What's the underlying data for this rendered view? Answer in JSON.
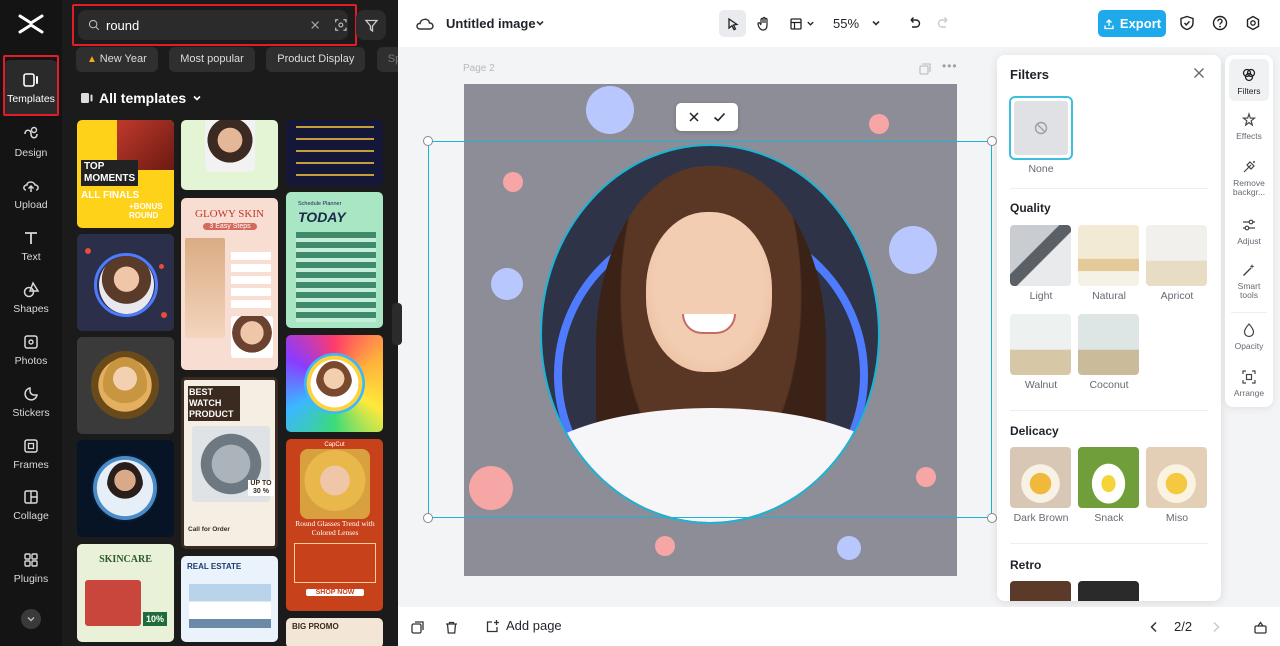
{
  "nav": {
    "items": [
      {
        "label": "Templates",
        "icon": "templates-icon"
      },
      {
        "label": "Design",
        "icon": "design-icon"
      },
      {
        "label": "Upload",
        "icon": "upload-icon"
      },
      {
        "label": "Text",
        "icon": "text-icon"
      },
      {
        "label": "Shapes",
        "icon": "shapes-icon"
      },
      {
        "label": "Photos",
        "icon": "photos-icon"
      },
      {
        "label": "Stickers",
        "icon": "stickers-icon"
      },
      {
        "label": "Frames",
        "icon": "frames-icon"
      },
      {
        "label": "Collage",
        "icon": "collage-icon"
      },
      {
        "label": "Plugins",
        "icon": "plugins-icon"
      }
    ]
  },
  "templates_panel": {
    "search_value": "round",
    "chips": [
      "New Year",
      "Most popular",
      "Product Display",
      "Spri"
    ],
    "all_templates_label": "All templates",
    "thumb_text": {
      "top_moments": "TOP\nMOMENTS",
      "all_finals": "ALL FINALS",
      "bonus_round": "+BONUS ROUND",
      "glowy_skin": "GLOWY SKIN",
      "easy_steps": "3 Easy Steps",
      "today": "TODAY",
      "schedule_planner": "Schedule Planner",
      "best_watch": "BEST WATCH PRODUCT",
      "watch_discount": "UP TO 30 %",
      "call_for_order": "Call for Order",
      "round_glasses": "Round Glasses Trend with Colored Lenses",
      "shop_now": "SHOP NOW",
      "skincare": "SKINCARE",
      "discount_10": "10%",
      "real_estate": "REAL ESTATE",
      "big_promo": "BIG PROMO",
      "capcut": "CapCut"
    }
  },
  "topbar": {
    "title": "Untitled image",
    "zoom": "55%",
    "export_label": "Export"
  },
  "canvas": {
    "page_label": "Page 2"
  },
  "filters_panel": {
    "title": "Filters",
    "none_label": "None",
    "sections": [
      {
        "name": "Quality",
        "items": [
          "Light",
          "Natural",
          "Apricot",
          "Walnut",
          "Coconut"
        ]
      },
      {
        "name": "Delicacy",
        "items": [
          "Dark Brown",
          "Snack",
          "Miso"
        ]
      },
      {
        "name": "Retro",
        "items": []
      }
    ]
  },
  "right_tools": [
    {
      "label": "Filters",
      "icon": "filters-icon"
    },
    {
      "label": "Effects",
      "icon": "effects-icon"
    },
    {
      "label": "Remove backgr...",
      "icon": "remove-background-icon"
    },
    {
      "label": "Adjust",
      "icon": "adjust-icon"
    },
    {
      "label": "Smart tools",
      "icon": "smart-tools-icon"
    },
    {
      "label": "Opacity",
      "icon": "opacity-icon"
    },
    {
      "label": "Arrange",
      "icon": "arrange-icon"
    }
  ],
  "bottombar": {
    "add_page_label": "Add page",
    "page_indicator": "2/2"
  },
  "colors": {
    "accent": "#1ea9ea",
    "selection": "#1ab4d6",
    "highlight": "#e11d2a",
    "dark_bg": "#1b1b1b"
  }
}
